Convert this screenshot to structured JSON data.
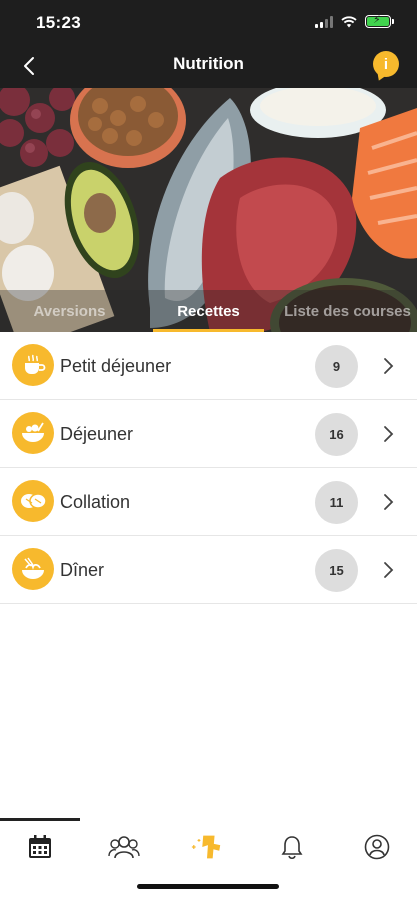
{
  "status_bar": {
    "time": "15:23"
  },
  "header": {
    "title": "Nutrition",
    "info_label": "i"
  },
  "tabs": [
    {
      "label": "Aversions",
      "active": false
    },
    {
      "label": "Recettes",
      "active": true
    },
    {
      "label": "Liste des courses",
      "active": false
    }
  ],
  "meals": [
    {
      "label": "Petit déjeuner",
      "count": "9",
      "icon": "coffee-cup-icon"
    },
    {
      "label": "Déjeuner",
      "count": "16",
      "icon": "salad-bowl-icon"
    },
    {
      "label": "Collation",
      "count": "11",
      "icon": "snack-icon"
    },
    {
      "label": "Dîner",
      "count": "15",
      "icon": "dinner-bowl-icon"
    }
  ],
  "bottom_nav": [
    {
      "name": "calendar-icon",
      "active": true
    },
    {
      "name": "community-icon",
      "active": false
    },
    {
      "name": "nutrition-coach-icon",
      "active": false
    },
    {
      "name": "bell-icon",
      "active": false
    },
    {
      "name": "profile-icon",
      "active": false
    }
  ],
  "colors": {
    "accent": "#f7b92d",
    "header_bg": "#1e1e1e",
    "count_bg": "#dddddd"
  }
}
